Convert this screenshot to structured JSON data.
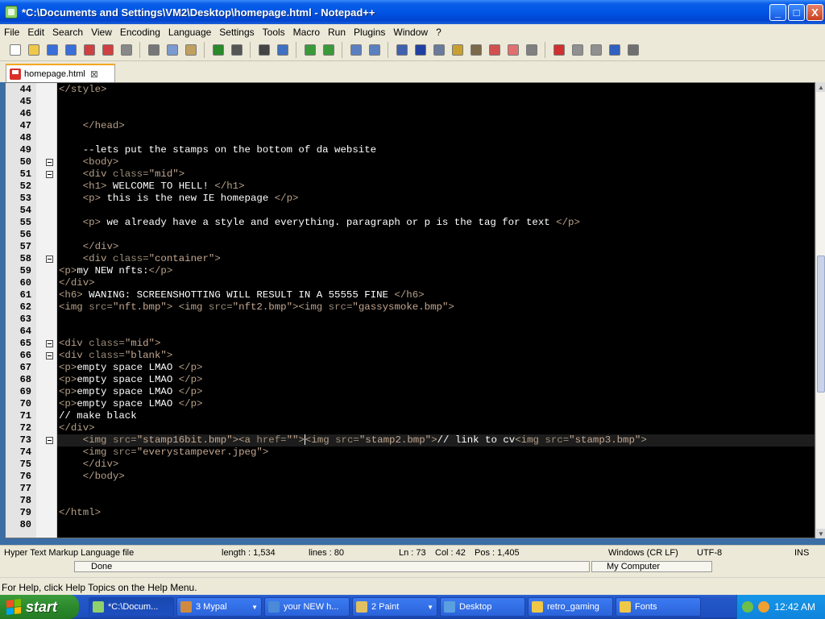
{
  "window": {
    "title": "*C:\\Documents and Settings\\VM2\\Desktop\\homepage.html - Notepad++",
    "controls": {
      "minimize": "_",
      "maximize": "□",
      "close": "X"
    }
  },
  "menu": [
    "File",
    "Edit",
    "Search",
    "View",
    "Encoding",
    "Language",
    "Settings",
    "Tools",
    "Macro",
    "Run",
    "Plugins",
    "Window",
    "?"
  ],
  "toolbar_icons": [
    "new-file-icon",
    "open-file-icon",
    "save-icon",
    "save-all-icon",
    "close-icon",
    "close-all-icon",
    "print-icon",
    "cut-icon",
    "copy-icon",
    "paste-icon",
    "undo-icon",
    "redo-icon",
    "find-icon",
    "replace-icon",
    "zoom-in-icon",
    "zoom-out-icon",
    "sync-v-icon",
    "sync-h-icon",
    "word-wrap-icon",
    "show-all-chars-icon",
    "indent-guide-icon",
    "user-lang-icon",
    "doc-map-icon",
    "function-list-icon",
    "folder-workspace-icon",
    "monitor-icon",
    "record-macro-icon",
    "stop-macro-icon",
    "play-macro-icon",
    "run-macro-multiple-icon",
    "save-macro-icon"
  ],
  "tab": {
    "label": "homepage.html",
    "close": "⊠"
  },
  "editor": {
    "lines": [
      {
        "n": "44",
        "fold": false,
        "parts": [
          [
            "tag",
            "</style>"
          ]
        ]
      },
      {
        "n": "45",
        "fold": false,
        "parts": []
      },
      {
        "n": "46",
        "fold": false,
        "parts": []
      },
      {
        "n": "47",
        "fold": false,
        "parts": [
          [
            "txt",
            "    "
          ],
          [
            "tag",
            "</head>"
          ]
        ]
      },
      {
        "n": "48",
        "fold": false,
        "parts": []
      },
      {
        "n": "49",
        "fold": false,
        "parts": [
          [
            "txt",
            "    --lets put the stamps on the bottom of da website"
          ]
        ]
      },
      {
        "n": "50",
        "fold": true,
        "parts": [
          [
            "txt",
            "    "
          ],
          [
            "tag",
            "<body>"
          ]
        ]
      },
      {
        "n": "51",
        "fold": true,
        "parts": [
          [
            "txt",
            "    "
          ],
          [
            "tag",
            "<div "
          ],
          [
            "attr",
            "class="
          ],
          [
            "str",
            "\"mid\""
          ],
          [
            "tag",
            ">"
          ]
        ]
      },
      {
        "n": "52",
        "fold": false,
        "parts": [
          [
            "txt",
            "    "
          ],
          [
            "tag",
            "<h1>"
          ],
          [
            "txt",
            " WELCOME TO HELL! "
          ],
          [
            "tag",
            "</h1>"
          ]
        ]
      },
      {
        "n": "53",
        "fold": false,
        "parts": [
          [
            "txt",
            "    "
          ],
          [
            "tag",
            "<p>"
          ],
          [
            "txt",
            " this is the new IE homepage "
          ],
          [
            "tag",
            "</p>"
          ]
        ]
      },
      {
        "n": "54",
        "fold": false,
        "parts": []
      },
      {
        "n": "55",
        "fold": false,
        "parts": [
          [
            "txt",
            "    "
          ],
          [
            "tag",
            "<p>"
          ],
          [
            "txt",
            " we already have a style and everything. paragraph or p is the tag for text "
          ],
          [
            "tag",
            "</p>"
          ]
        ]
      },
      {
        "n": "56",
        "fold": false,
        "parts": []
      },
      {
        "n": "57",
        "fold": false,
        "parts": [
          [
            "txt",
            "    "
          ],
          [
            "tag",
            "</div>"
          ]
        ]
      },
      {
        "n": "58",
        "fold": true,
        "parts": [
          [
            "txt",
            "    "
          ],
          [
            "tag",
            "<div "
          ],
          [
            "attr",
            "class="
          ],
          [
            "str",
            "\"container\""
          ],
          [
            "tag",
            ">"
          ]
        ]
      },
      {
        "n": "59",
        "fold": false,
        "parts": [
          [
            "tag",
            "<p>"
          ],
          [
            "txt",
            "my NEW nfts:"
          ],
          [
            "tag",
            "</p>"
          ]
        ]
      },
      {
        "n": "60",
        "fold": false,
        "parts": [
          [
            "tag",
            "</div>"
          ]
        ]
      },
      {
        "n": "61",
        "fold": false,
        "parts": [
          [
            "tag",
            "<h6>"
          ],
          [
            "txt",
            " WANING: SCREENSHOTTING WILL RESULT IN A 55555 FINE "
          ],
          [
            "tag",
            "</h6>"
          ]
        ]
      },
      {
        "n": "62",
        "fold": false,
        "parts": [
          [
            "tag",
            "<img "
          ],
          [
            "attr",
            "src="
          ],
          [
            "str",
            "\"nft.bmp\""
          ],
          [
            "tag",
            ">"
          ],
          [
            "txt",
            " "
          ],
          [
            "tag",
            "<img "
          ],
          [
            "attr",
            "src="
          ],
          [
            "str",
            "\"nft2.bmp\""
          ],
          [
            "tag",
            ">"
          ],
          [
            "tag",
            "<img "
          ],
          [
            "attr",
            "src="
          ],
          [
            "str",
            "\"gassysmoke.bmp\""
          ],
          [
            "tag",
            ">"
          ]
        ]
      },
      {
        "n": "63",
        "fold": false,
        "parts": []
      },
      {
        "n": "64",
        "fold": false,
        "parts": []
      },
      {
        "n": "65",
        "fold": true,
        "parts": [
          [
            "tag",
            "<div "
          ],
          [
            "attr",
            "class="
          ],
          [
            "str",
            "\"mid\""
          ],
          [
            "tag",
            ">"
          ]
        ]
      },
      {
        "n": "66",
        "fold": true,
        "parts": [
          [
            "tag",
            "<div "
          ],
          [
            "attr",
            "class="
          ],
          [
            "str",
            "\"blank\""
          ],
          [
            "tag",
            ">"
          ]
        ]
      },
      {
        "n": "67",
        "fold": false,
        "parts": [
          [
            "tag",
            "<p>"
          ],
          [
            "txt",
            "empty space LMAO "
          ],
          [
            "tag",
            "</p>"
          ]
        ]
      },
      {
        "n": "68",
        "fold": false,
        "parts": [
          [
            "tag",
            "<p>"
          ],
          [
            "txt",
            "empty space LMAO "
          ],
          [
            "tag",
            "</p>"
          ]
        ]
      },
      {
        "n": "69",
        "fold": false,
        "parts": [
          [
            "tag",
            "<p>"
          ],
          [
            "txt",
            "empty space LMAO "
          ],
          [
            "tag",
            "</p>"
          ]
        ]
      },
      {
        "n": "70",
        "fold": false,
        "parts": [
          [
            "tag",
            "<p>"
          ],
          [
            "txt",
            "empty space LMAO "
          ],
          [
            "tag",
            "</p>"
          ]
        ]
      },
      {
        "n": "71",
        "fold": false,
        "parts": [
          [
            "txt",
            "// make black"
          ]
        ]
      },
      {
        "n": "72",
        "fold": false,
        "parts": [
          [
            "tag",
            "</div>"
          ]
        ]
      },
      {
        "n": "73",
        "fold": true,
        "current": true,
        "parts": [
          [
            "txt",
            "    "
          ],
          [
            "tag",
            "<img "
          ],
          [
            "attr",
            "src="
          ],
          [
            "str",
            "\"stamp16bit.bmp\""
          ],
          [
            "tag",
            ">"
          ],
          [
            "tag",
            "<a "
          ],
          [
            "attr",
            "href="
          ],
          [
            "str",
            "\"\""
          ],
          [
            "tag",
            ">"
          ],
          [
            "caret",
            ""
          ],
          [
            "tag",
            "<img "
          ],
          [
            "attr",
            "src="
          ],
          [
            "str",
            "\"stamp2.bmp\""
          ],
          [
            "tag",
            ">"
          ],
          [
            "txt",
            "// link to cv"
          ],
          [
            "tag",
            "<img "
          ],
          [
            "attr",
            "src="
          ],
          [
            "str",
            "\"stamp3.bmp\""
          ],
          [
            "tag",
            ">"
          ]
        ]
      },
      {
        "n": "74",
        "fold": false,
        "parts": [
          [
            "txt",
            "    "
          ],
          [
            "tag",
            "<img "
          ],
          [
            "attr",
            "src="
          ],
          [
            "str",
            "\"everystampever.jpeg\""
          ],
          [
            "tag",
            ">"
          ]
        ]
      },
      {
        "n": "75",
        "fold": false,
        "parts": [
          [
            "txt",
            "    "
          ],
          [
            "tag",
            "</div>"
          ]
        ]
      },
      {
        "n": "76",
        "fold": false,
        "parts": [
          [
            "txt",
            "    "
          ],
          [
            "tag",
            "</body>"
          ]
        ]
      },
      {
        "n": "77",
        "fold": false,
        "parts": []
      },
      {
        "n": "78",
        "fold": false,
        "parts": []
      },
      {
        "n": "79",
        "fold": false,
        "parts": [
          [
            "tag",
            "</html>"
          ]
        ]
      },
      {
        "n": "80",
        "fold": false,
        "parts": []
      }
    ]
  },
  "status": {
    "filetype": "Hyper Text Markup Language file",
    "length": "length : 1,534",
    "lines": "lines : 80",
    "ln": "Ln : 73",
    "col": "Col : 42",
    "pos": "Pos : 1,405",
    "eol": "Windows (CR LF)",
    "encoding": "UTF-8",
    "ins": "INS"
  },
  "ie_status": {
    "done": "Done",
    "zone": "My Computer"
  },
  "help_text": "For Help, click Help Topics on the Help Menu.",
  "taskbar": {
    "start": "start",
    "tasks": [
      {
        "label": "*C:\\Docum...",
        "active": true,
        "color": "#8fd16a",
        "dropdown": false,
        "w": 106
      },
      {
        "label": "3 Mypal",
        "active": false,
        "color": "#d08a40",
        "dropdown": true,
        "w": 106
      },
      {
        "label": "your NEW h...",
        "active": false,
        "color": "#4a8ad8",
        "dropdown": false,
        "w": 106
      },
      {
        "label": "2 Paint",
        "active": false,
        "color": "#e0c060",
        "dropdown": true,
        "w": 106
      },
      {
        "label": "Desktop",
        "active": false,
        "color": "#5aa0e0",
        "dropdown": false,
        "w": 106
      },
      {
        "label": "retro_gaming",
        "active": false,
        "color": "#f0c848",
        "dropdown": false,
        "w": 106
      },
      {
        "label": "Fonts",
        "active": false,
        "color": "#f0c848",
        "dropdown": false,
        "w": 106
      }
    ],
    "clock": "12:42 AM"
  }
}
